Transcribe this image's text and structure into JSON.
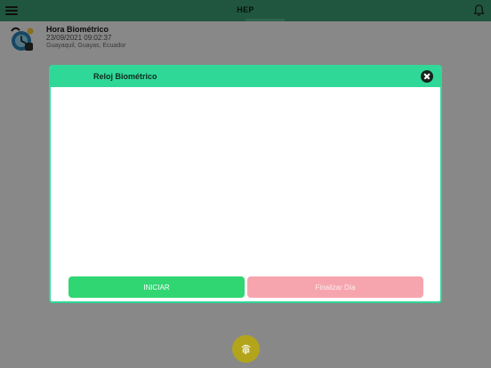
{
  "appbar": {
    "title": "HEP",
    "menu_icon": "hamburger-menu-icon",
    "notification_icon": "bell-icon",
    "color": "#3a9a72"
  },
  "info": {
    "icon": "biometric-clock-logo",
    "title": "Hora Biométrico",
    "datetime": "23/09/2021 09:02:37",
    "location": "Guayaquil, Guayas, Ecuador"
  },
  "dialog": {
    "title": "Reloj Biométrico",
    "close_icon": "close-icon",
    "accent_color": "#2fd897",
    "start_label": "INICIAR",
    "end_label": "Finalizar Día",
    "start_color": "#2fd671",
    "end_color": "#f6a5ae"
  },
  "fab": {
    "icon": "fingerprint-icon",
    "color": "#b2a51c"
  }
}
